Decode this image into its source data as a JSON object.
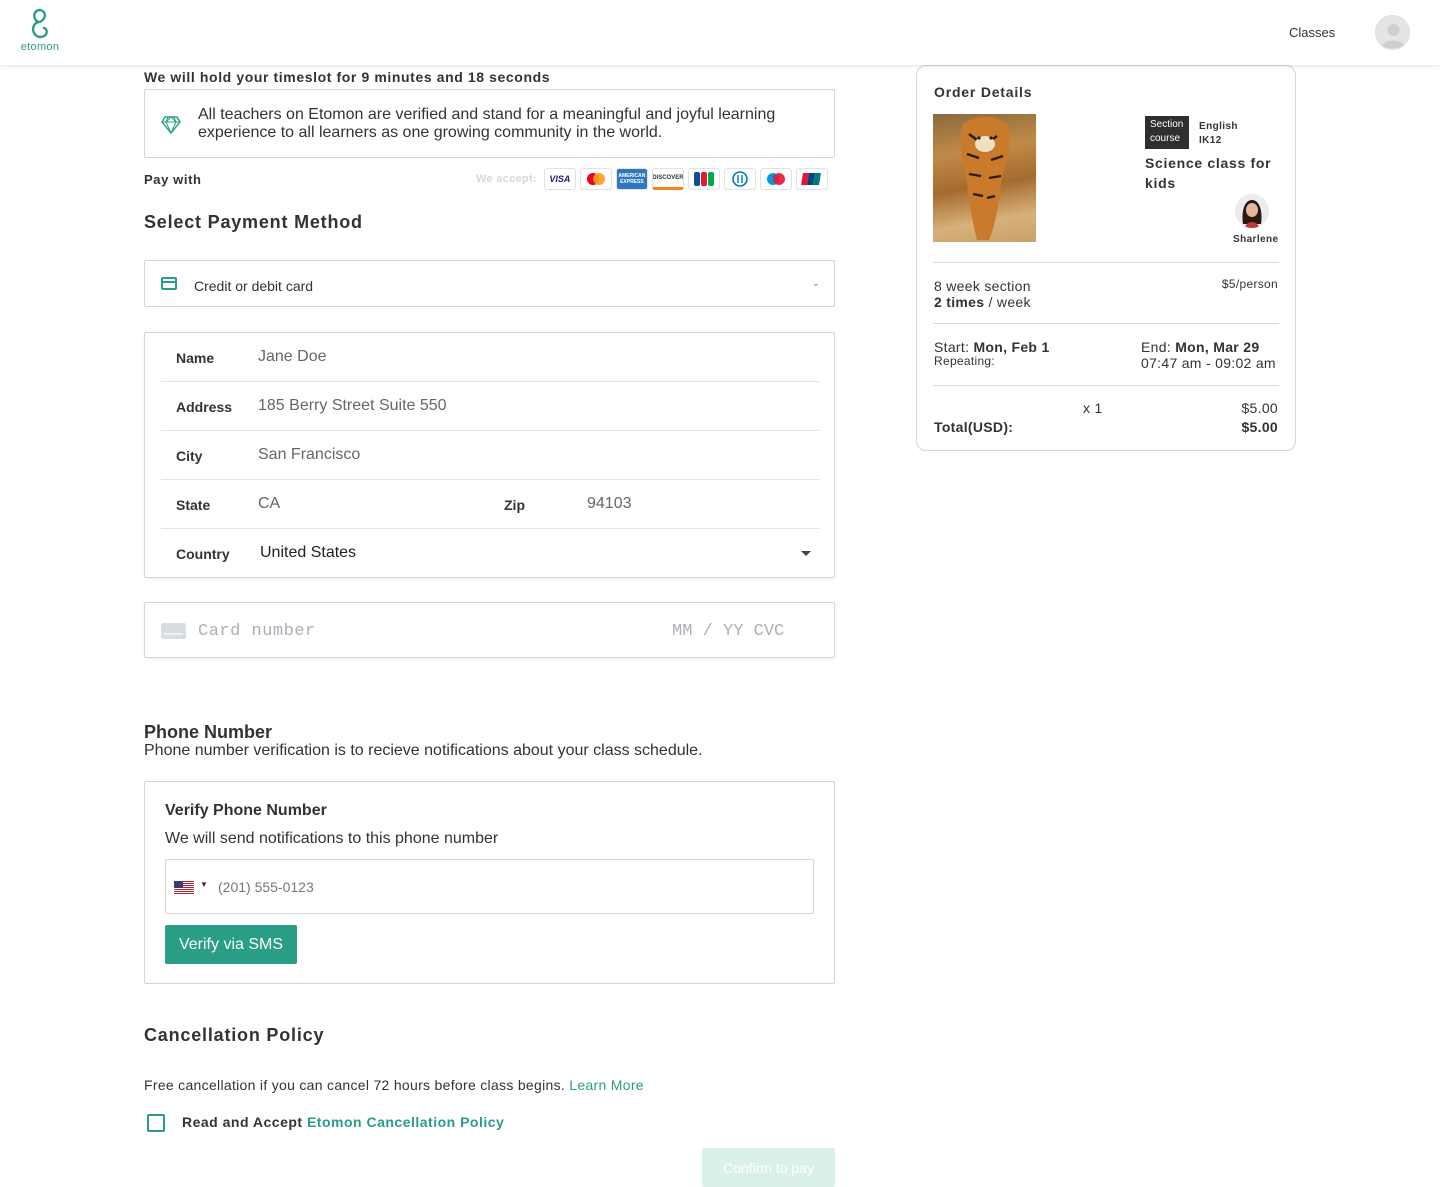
{
  "header": {
    "logo_text": "etomon",
    "nav_classes": "Classes"
  },
  "checkout": {
    "hold_text": "We will hold your timeslot for 9 minutes and 18 seconds",
    "notice_text": "All teachers on Etomon are verified and stand for a meaningful and joyful learning experience to all learners as one growing community in the world.",
    "pay_with": "Pay with",
    "we_accept": "We accept:",
    "card_brands": [
      "VISA",
      "mastercard",
      "AMERICAN EXPRESS",
      "DISCOVER",
      "JCB",
      "Diners Club",
      "maestro",
      "UnionPay"
    ],
    "select_payment_title": "Select Payment Method",
    "payment_method": "Credit or debit card"
  },
  "address": {
    "name_label": "Name",
    "name_value": "Jane Doe",
    "address_label": "Address",
    "address_value": "185 Berry Street Suite 550",
    "city_label": "City",
    "city_value": "San Francisco",
    "state_label": "State",
    "state_value": "CA",
    "zip_label": "Zip",
    "zip_value": "94103",
    "country_label": "Country",
    "country_value": "United States"
  },
  "card": {
    "number_placeholder": "Card number",
    "exp_cvc_placeholder": "MM / YY CVC"
  },
  "phone": {
    "title": "Phone Number",
    "description": "Phone number verification is to recieve notifications about your class schedule.",
    "verify_title": "Verify Phone Number",
    "verify_desc": "We will send notifications to this phone number",
    "placeholder": "(201) 555-0123",
    "sms_button": "Verify via SMS"
  },
  "cancellation": {
    "title": "Cancellation Policy",
    "desc": "Free cancellation if you can cancel 72 hours before class begins.",
    "learn_more": "Learn More",
    "accept_prefix": "Read and Accept",
    "policy_link": "Etomon Cancellation Policy",
    "accepted": false,
    "confirm_button": "Confirm to pay"
  },
  "order": {
    "title": "Order Details",
    "badge_line1": "Section",
    "badge_line2": "course",
    "language": "English",
    "level": "IK12",
    "course_title": "Science class for kids",
    "teacher": "Sharlene",
    "section_length": "8 week section",
    "frequency_bold": "2 times",
    "frequency_rest": " / week",
    "price_per": "$5/person",
    "start_label": "Start: ",
    "start_value": "Mon, Feb 1",
    "repeating": "Repeating:",
    "end_label": "End: ",
    "end_value": "Mon, Mar 29",
    "time_range": "07:47 am - 09:02 am",
    "quantity": "x 1",
    "line_amount": "$5.00",
    "total_label": "Total(USD):",
    "total_value": "$5.00"
  },
  "colors": {
    "brand": "#2a9d86",
    "confirm_disabled": "#d9f0eb"
  }
}
